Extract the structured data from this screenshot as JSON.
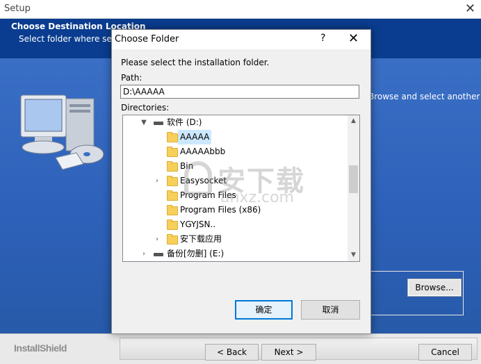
{
  "setup": {
    "title": "Setup",
    "close_glyph": "✕",
    "header_title": "Choose Destination Location",
    "header_subtitle": "Select folder where setup wi",
    "side_text": "Browse and select another",
    "browse_label": "Browse...",
    "brand": "InstallShield",
    "back_label": "< Back",
    "next_label": "Next >",
    "cancel_label": "Cancel"
  },
  "dialog": {
    "title": "Choose Folder",
    "help_glyph": "?",
    "close_glyph": "✕",
    "instruction": "Please select the installation folder.",
    "path_label": "Path:",
    "path_value": "D:\\AAAAA",
    "directories_label": "Directories:",
    "tree": [
      {
        "label": "软件 (D:)",
        "type": "drive",
        "expanded": true
      },
      {
        "label": "AAAAA",
        "type": "folder",
        "selected": true
      },
      {
        "label": "AAAAAbbb",
        "type": "folder"
      },
      {
        "label": "Bin",
        "type": "folder"
      },
      {
        "label": "Easysocket",
        "type": "folder",
        "expandable": true
      },
      {
        "label": "Program Files",
        "type": "folder"
      },
      {
        "label": "Program Files (x86)",
        "type": "folder"
      },
      {
        "label": "YGYJSN..",
        "type": "folder"
      },
      {
        "label": "安下载应用",
        "type": "folder",
        "expandable": true
      },
      {
        "label": "备份[勿删] (E:)",
        "type": "drive",
        "expandable": true
      }
    ],
    "ok_label": "确定",
    "cancel_label": "取消"
  },
  "watermark": {
    "text_cn": "安下载",
    "text_en": "anxz.com"
  }
}
